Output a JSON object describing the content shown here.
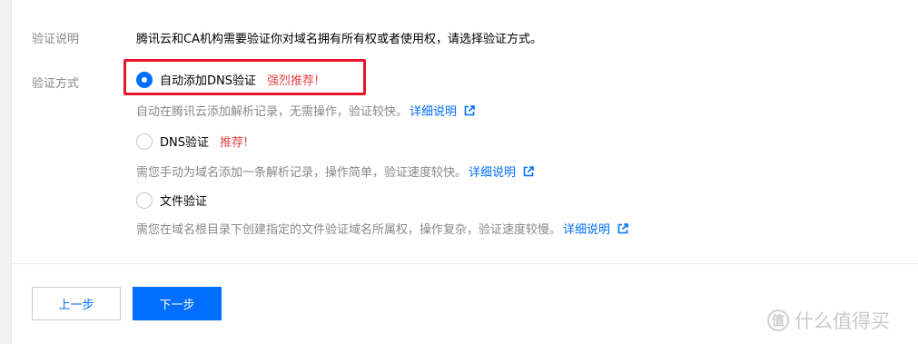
{
  "verification": {
    "description_label": "验证说明",
    "description_text": "腾讯云和CA机构需要验证你对域名拥有所有权或者使用权，请选择验证方式。",
    "method_label": "验证方式",
    "options": [
      {
        "label": "自动添加DNS验证",
        "recommend": "强烈推荐!",
        "checked": true,
        "desc": "自动在腾讯云添加解析记录，无需操作，验证较快。",
        "link": "详细说明"
      },
      {
        "label": "DNS验证",
        "recommend": "推荐!",
        "checked": false,
        "desc": "需您手动为域名添加一条解析记录，操作简单，验证速度较快。",
        "link": "详细说明"
      },
      {
        "label": "文件验证",
        "recommend": "",
        "checked": false,
        "desc": "需您在域名根目录下创建指定的文件验证域名所属权，操作复杂，验证速度较慢。",
        "link": "详细说明"
      }
    ]
  },
  "footer": {
    "prev_label": "上一步",
    "next_label": "下一步"
  },
  "watermark": {
    "badge": "值",
    "text": "什么值得买"
  },
  "colors": {
    "accent": "#006eff",
    "recommend": "#e54545",
    "highlight": "#e8152a",
    "muted": "#888888"
  },
  "icons": {
    "external_link": "external-link-icon",
    "radio_checked": "radio-checked-icon",
    "radio_unchecked": "radio-unchecked-icon"
  }
}
